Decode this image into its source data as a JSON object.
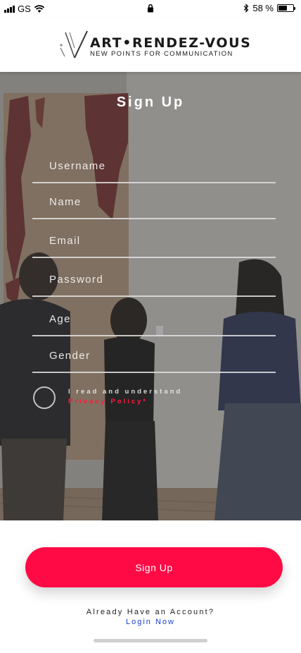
{
  "status_bar": {
    "carrier": "GS",
    "battery_percent": "58 %",
    "battery_level": 0.58,
    "icons": [
      "signal-icon",
      "wifi-icon",
      "lock-icon",
      "bluetooth-icon",
      "battery-icon"
    ]
  },
  "header": {
    "logo_title": "ART•RENDEZ-VOUS",
    "logo_subtitle": "NEW POINTS FOR COMMUNICATION"
  },
  "form": {
    "title": "Sign Up",
    "fields": {
      "username": "Username",
      "name": "Name",
      "email": "Email",
      "password": "Password",
      "age": "Age",
      "gender": "Gender"
    },
    "agree_text": "I read and understand",
    "privacy_link": "Privacy Policy*"
  },
  "signup_button": "Sign Up",
  "footer": {
    "already_text": "Already Have an Account?",
    "login_link": "Login Now"
  },
  "colors": {
    "accent": "#ff0a45",
    "privacy_red": "#ff1a3c",
    "link_blue": "#1a3fd6"
  }
}
